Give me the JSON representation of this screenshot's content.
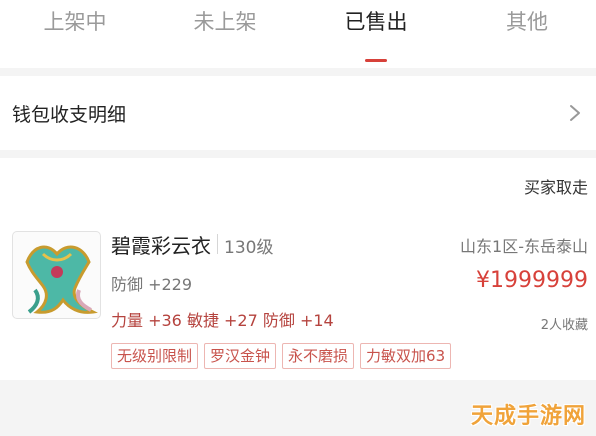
{
  "tabs": [
    {
      "label": "上架中"
    },
    {
      "label": "未上架"
    },
    {
      "label": "已售出"
    },
    {
      "label": "其他"
    }
  ],
  "active_tab": "已售出",
  "wallet": {
    "label": "钱包收支明细",
    "icon": "chevron-right-icon"
  },
  "order": {
    "status": "买家取走",
    "item_name": "碧霞彩云衣",
    "level": "130级",
    "server": "山东1区-东岳泰山",
    "defense": "防御 +229",
    "price": "¥1999999",
    "stats": "力量 +36 敏捷 +27 防御 +14",
    "favorites": "2人收藏",
    "tags": [
      "无级别限制",
      "罗汉金钟",
      "永不磨损",
      "力敏双加63"
    ]
  },
  "watermark": "天成手游网",
  "colors": {
    "accent": "#d7413a",
    "tag_border": "#edb6b2",
    "watermark": "#f0a33a"
  }
}
